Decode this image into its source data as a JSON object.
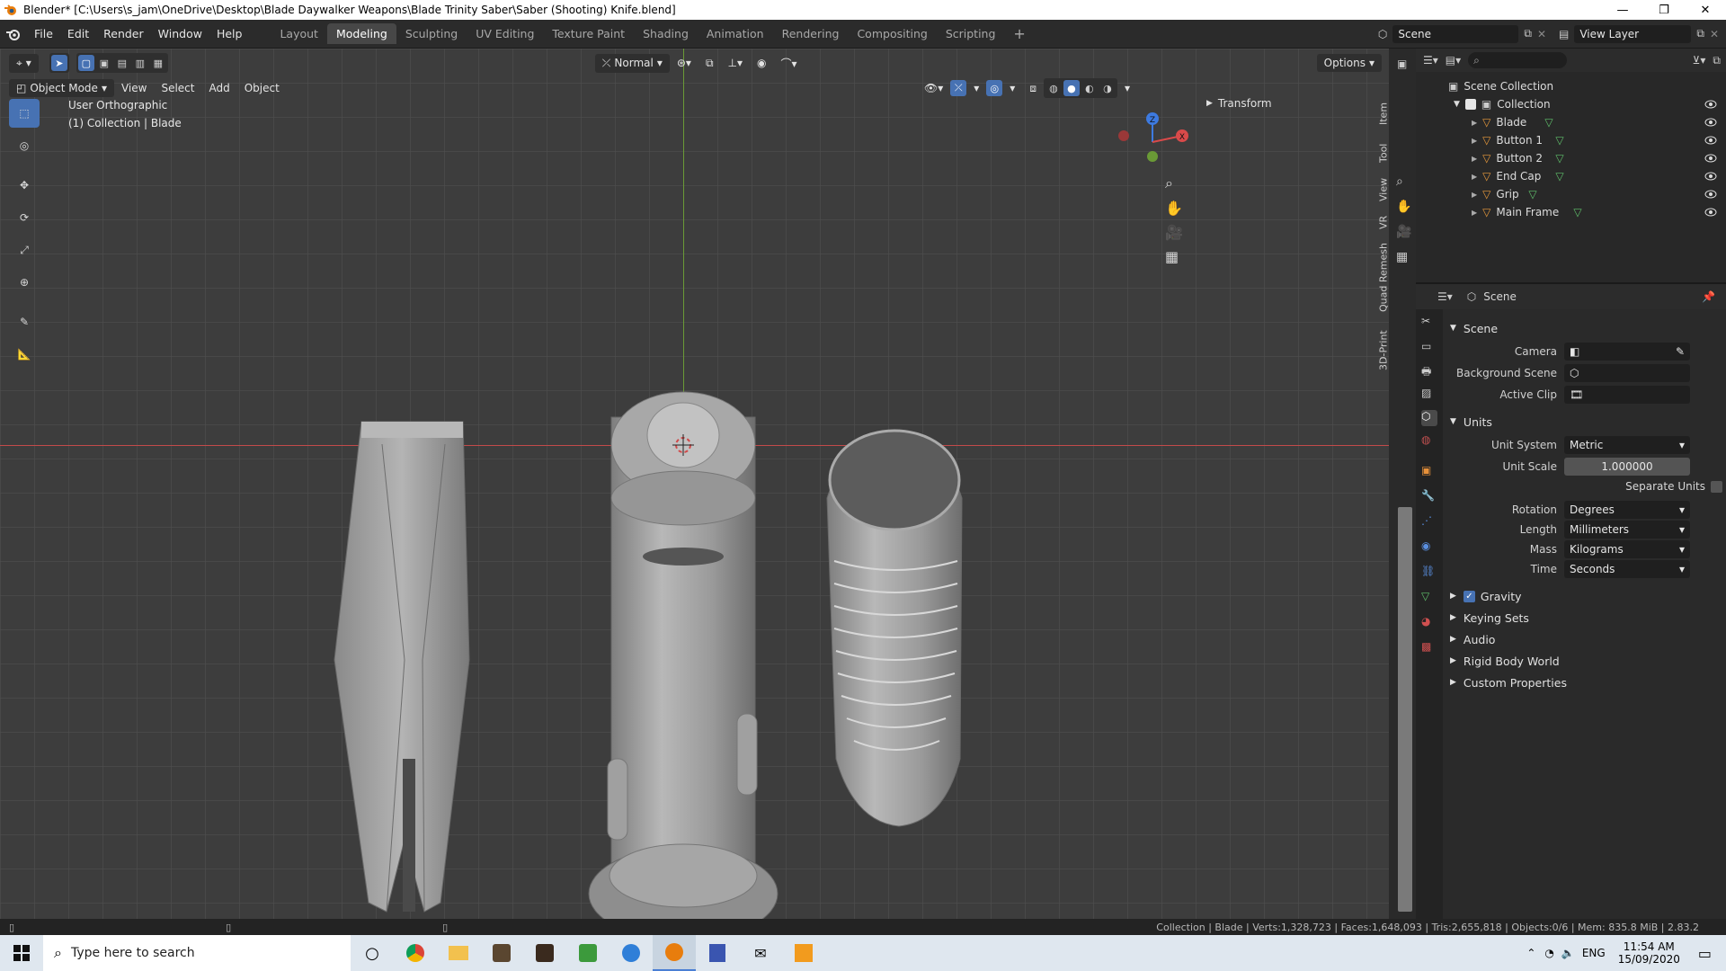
{
  "window": {
    "title": "Blender* [C:\\Users\\s_jam\\OneDrive\\Desktop\\Blade Daywalker Weapons\\Blade Trinity Saber\\Saber (Shooting) Knife.blend]",
    "min": "—",
    "max": "❐",
    "close": "✕"
  },
  "menu": [
    "File",
    "Edit",
    "Render",
    "Window",
    "Help"
  ],
  "workspaces": [
    "Layout",
    "Modeling",
    "Sculpting",
    "UV Editing",
    "Texture Paint",
    "Shading",
    "Animation",
    "Rendering",
    "Compositing",
    "Scripting"
  ],
  "workspace_active": "Modeling",
  "scene_name": "Scene",
  "view_layer": "View Layer",
  "viewport": {
    "transform_orientation": "Normal",
    "options_label": "Options",
    "mode": "Object Mode",
    "menus": [
      "View",
      "Select",
      "Add",
      "Object"
    ],
    "view_name": "User Orthographic",
    "collection_info": "(1) Collection | Blade",
    "transform_panel": "Transform",
    "gizmo": {
      "z": "Z",
      "x": "X"
    },
    "sidebar_tabs": [
      "Item",
      "Tool",
      "View",
      "VR",
      "Quad Remesh",
      "3D-Print"
    ]
  },
  "outliner": {
    "root": "Scene Collection",
    "collection": "Collection",
    "objects": [
      "Blade",
      "Button 1",
      "Button 2",
      "End Cap",
      "Grip",
      "Main Frame"
    ]
  },
  "properties": {
    "header": "Scene",
    "section_scene": "Scene",
    "camera_label": "Camera",
    "bg_scene_label": "Background Scene",
    "active_clip_label": "Active Clip",
    "units_label": "Units",
    "unit_system_label": "Unit System",
    "unit_system": "Metric",
    "unit_scale_label": "Unit Scale",
    "unit_scale": "1.000000",
    "separate_units": "Separate Units",
    "rotation_label": "Rotation",
    "rotation": "Degrees",
    "length_label": "Length",
    "length": "Millimeters",
    "mass_label": "Mass",
    "mass": "Kilograms",
    "time_label": "Time",
    "time": "Seconds",
    "gravity": "Gravity",
    "collapsed": [
      "Keying Sets",
      "Audio",
      "Rigid Body World",
      "Custom Properties"
    ]
  },
  "status": "Collection | Blade | Verts:1,328,723 | Faces:1,648,093 | Tris:2,655,818 | Objects:0/6 | Mem: 835.8 MiB | 2.83.2",
  "taskbar": {
    "search_placeholder": "Type here to search",
    "lang": "ENG",
    "time": "11:54 AM",
    "date": "15/09/2020"
  },
  "colors": {
    "accent": "#4772b3",
    "axis_x": "#c34a4a",
    "axis_y": "#6a9a36",
    "viewport_bg": "#3d3d3d"
  }
}
